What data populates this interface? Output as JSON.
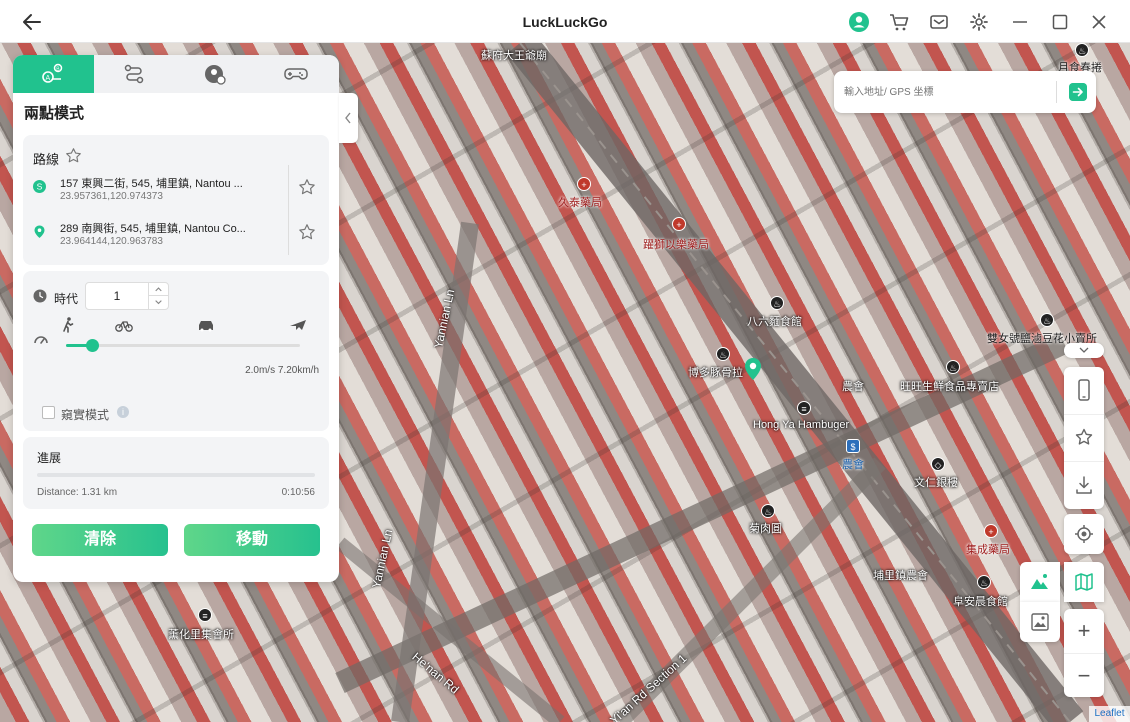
{
  "window": {
    "title": "LuckLuckGo"
  },
  "colors": {
    "accent": "#21c28e",
    "accent_light": "#5fd68a"
  },
  "search": {
    "placeholder": "輸入地址/ GPS 坐標"
  },
  "panel": {
    "mode_title": "兩點模式",
    "tabs": [
      {
        "icon": "two-point-route-icon",
        "active": true
      },
      {
        "icon": "multi-stop-route-icon",
        "active": false
      },
      {
        "icon": "jump-teleport-icon",
        "active": false
      },
      {
        "icon": "gamepad-icon",
        "active": false
      }
    ],
    "route": {
      "label": "路線",
      "start": {
        "address": "157 東興二街, 545, 埔里鎮, Nantou ...",
        "coords": "23.957361,120.974373",
        "marker": "S"
      },
      "end": {
        "address": "289 南興街, 545, 埔里鎮, Nantou Co...",
        "coords": "23.964144,120.963783"
      }
    },
    "speed": {
      "times_label": "時代",
      "times_value": "1",
      "slider_fraction": 0.11,
      "readout": "2.0m/s  7.20km/h",
      "modes": [
        "walk-icon",
        "bike-icon",
        "car-icon",
        "plane-icon"
      ]
    },
    "stealth": {
      "label": "窺實模式",
      "checked": false
    },
    "progress": {
      "label": "進展",
      "fraction": 0,
      "distance": "Distance: 1.31 km",
      "time": "0:10:56"
    },
    "buttons": {
      "clear": "清除",
      "move": "移動"
    }
  },
  "map": {
    "labels": [
      {
        "text": "蘇府大王爺廟",
        "style": ""
      },
      {
        "text": "月食春捲",
        "style": ""
      },
      {
        "text": "久泰藥局",
        "style": "red"
      },
      {
        "text": "躍獅以樂藥局",
        "style": "red"
      },
      {
        "text": "八六麵食館",
        "style": ""
      },
      {
        "text": "雙女號鹽滷豆花小賣所",
        "style": ""
      },
      {
        "text": "博多豚骨拉",
        "style": ""
      },
      {
        "text": "農會",
        "style": ""
      },
      {
        "text": "旺旺生鮮食品專賣店",
        "style": ""
      },
      {
        "text": "Hong Ya Hambuger",
        "style": ""
      },
      {
        "text": "農會",
        "style": "blue"
      },
      {
        "text": "文仁銀樓",
        "style": ""
      },
      {
        "text": "菊肉圓",
        "style": ""
      },
      {
        "text": "集成藥局",
        "style": "red"
      },
      {
        "text": "埔里鎮農會",
        "style": ""
      },
      {
        "text": "阜安晨食館",
        "style": ""
      },
      {
        "text": "薰化里集會所",
        "style": ""
      }
    ],
    "roads": [
      "Yannian Ln",
      "Yannian Ln",
      "He'nan Rd",
      "Yi'an Rd Section 1"
    ],
    "attribution": "Leaflet"
  }
}
